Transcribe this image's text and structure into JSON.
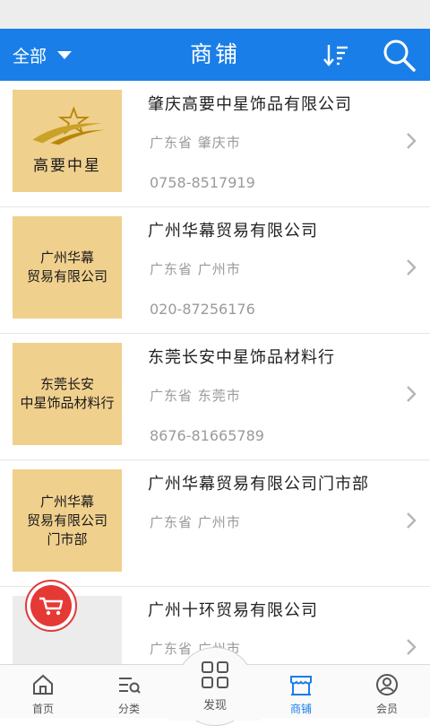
{
  "header": {
    "filter_label": "全部",
    "title": "商铺",
    "sort_icon": "sort-descending-icon",
    "search_icon": "search-icon",
    "bar_color": "#1a7ee8"
  },
  "shops": [
    {
      "name": "肇庆高要中星饰品有限公司",
      "location": "广东省 肇庆市",
      "phone": "0758-8517919",
      "logo_text": "高要中星"
    },
    {
      "name": "广州华幕贸易有限公司",
      "location": "广东省 广州市",
      "phone": "020-87256176",
      "logo_line1": "广州华幕",
      "logo_line2": "贸易有限公司"
    },
    {
      "name": "东莞长安中星饰品材料行",
      "location": "广东省 东莞市",
      "phone": "8676-81665789",
      "logo_line1": "东莞长安",
      "logo_line2": "中星饰品材料行"
    },
    {
      "name": "广州华幕贸易有限公司门市部",
      "location": "广东省 广州市",
      "phone": "",
      "logo_line1": "广州华幕",
      "logo_line2": "贸易有限公司",
      "logo_line3": "门市部"
    },
    {
      "name": "广州十环贸易有限公司",
      "location": "广东省 广州市",
      "phone": ""
    }
  ],
  "floating": {
    "cart_icon": "shopping-cart-icon",
    "cart_color": "#e53935"
  },
  "tabs": [
    {
      "label": "首页",
      "icon": "home-icon"
    },
    {
      "label": "分类",
      "icon": "category-list-icon"
    },
    {
      "label": "发现",
      "icon": "discover-grid-icon"
    },
    {
      "label": "商铺",
      "icon": "shop-icon",
      "active": true
    },
    {
      "label": "会员",
      "icon": "member-icon"
    }
  ]
}
